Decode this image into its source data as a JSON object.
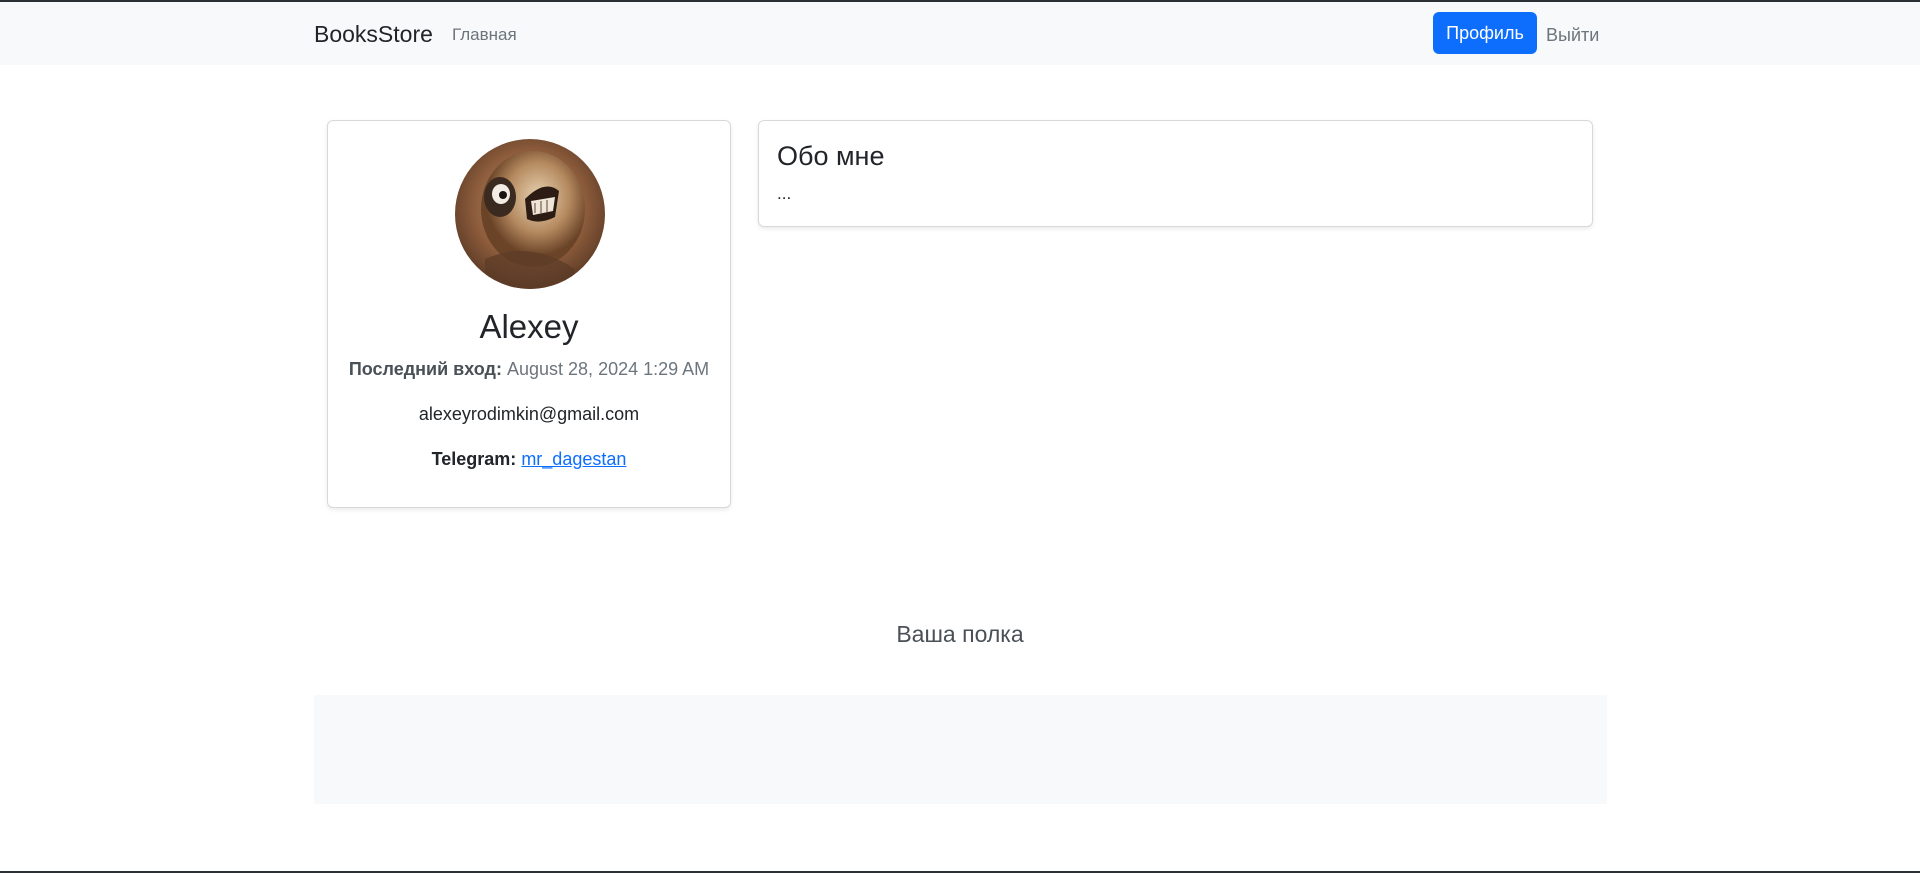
{
  "navbar": {
    "brand": "BooksStore",
    "home_label": "Главная",
    "profile_label": "Профиль",
    "logout_label": "Выйти",
    "accent_color": "#0d6efd"
  },
  "profile": {
    "avatar_alt": "avatar",
    "name": "Alexey",
    "last_login_label": "Последний вход:",
    "last_login_value": "August 28, 2024 1:29 AM",
    "email": "alexeyrodimkin@gmail.com",
    "telegram_label": "Telegram:",
    "telegram_handle": "mr_dagestan"
  },
  "about": {
    "title": "Обо мне",
    "text": "..."
  },
  "shelf": {
    "title": "Ваша полка"
  }
}
